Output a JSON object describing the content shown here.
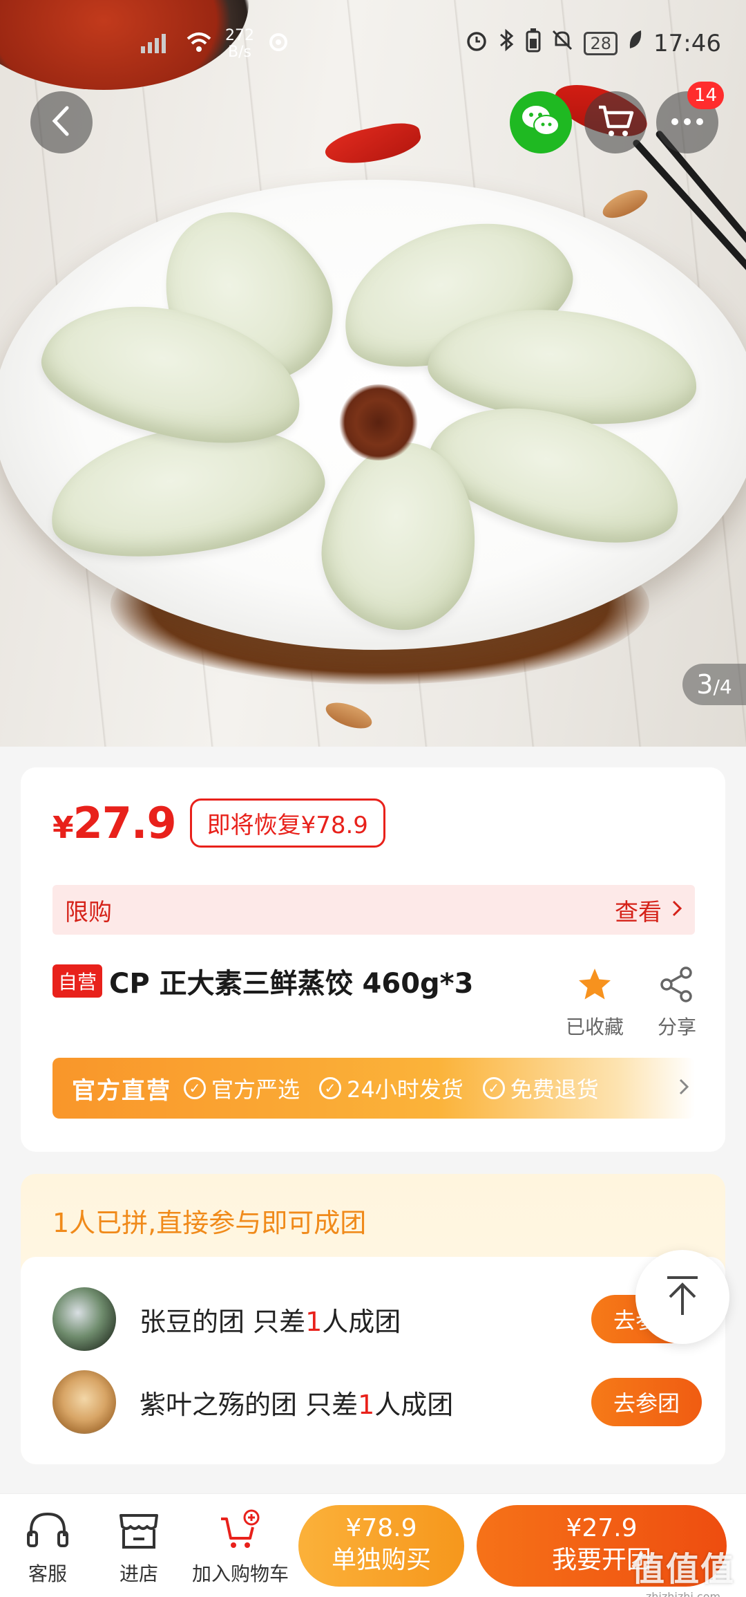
{
  "status_bar": {
    "net_speed_value": "272",
    "net_speed_unit": "B/s",
    "battery": "28",
    "time": "17:46"
  },
  "nav": {
    "cart_badge": "14"
  },
  "gallery": {
    "current": "3",
    "total": "/4"
  },
  "product": {
    "currency": "¥",
    "price": "27.9",
    "restore_price_label": "即将恢复¥78.9",
    "limit_label": "限购",
    "limit_view": "查看",
    "self_operated_tag": "自营",
    "title": "CP 正大素三鲜蒸饺 460g*3",
    "favorite_label": "已收藏",
    "share_label": "分享"
  },
  "official": {
    "brand": "官方直营",
    "features": [
      "官方严选",
      "24小时发货",
      "免费退货"
    ]
  },
  "group_buy": {
    "header": "1人已拼,直接参与即可成团",
    "groups": [
      {
        "owner_text": "张豆的团 只差",
        "count": "1",
        "suffix": "人成团",
        "button": "去参团"
      },
      {
        "owner_text": "紫叶之殇的团 只差",
        "count": "1",
        "suffix": "人成团",
        "button": "去参团"
      }
    ]
  },
  "bottom_bar": {
    "service_label": "客服",
    "store_label": "进店",
    "add_cart_label": "加入购物车",
    "single_price": "¥78.9",
    "single_label": "单独购买",
    "group_price": "¥27.9",
    "group_label": "我要开团"
  },
  "watermark": {
    "text": "值值值",
    "url": "zhizhizhi.com"
  },
  "colors": {
    "accent_red": "#e8211b",
    "accent_orange": "#f05c12",
    "wechat_green": "#1fb922"
  }
}
